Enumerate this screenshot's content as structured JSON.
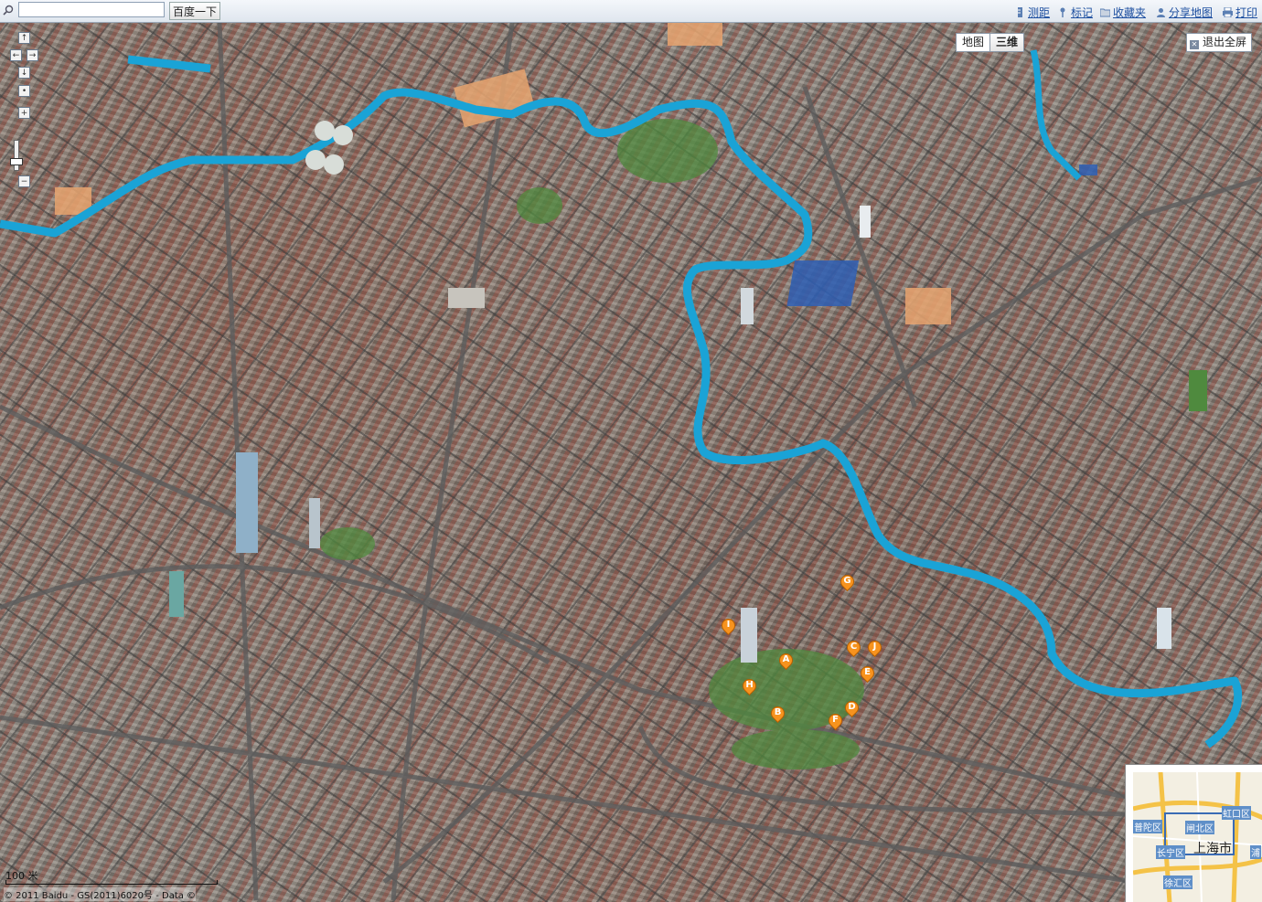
{
  "toolbar": {
    "search_placeholder": "",
    "search_button": "百度一下",
    "links": [
      {
        "id": "measure",
        "label": "测距",
        "icon": "ruler-icon"
      },
      {
        "id": "mark",
        "label": "标记",
        "icon": "pin-icon"
      },
      {
        "id": "favorites",
        "label": "收藏夹",
        "icon": "folder-icon"
      },
      {
        "id": "share",
        "label": "分享地图",
        "icon": "share-icon"
      },
      {
        "id": "print",
        "label": "打印",
        "icon": "printer-icon"
      }
    ]
  },
  "map": {
    "view": "3D aerial city view",
    "type_switch": {
      "map_label": "地图",
      "threed_label": "三维",
      "active": "三维"
    },
    "exit_fullscreen": "退出全屏",
    "markers": [
      "A",
      "B",
      "C",
      "D",
      "E",
      "F",
      "G",
      "H",
      "I",
      "J"
    ],
    "scale_label": "100 米",
    "copyright": "© 2011 Baidu - GS(2011)6020号 - Data ©",
    "colors": {
      "river": "#1aa3d6",
      "marker": "#f7931e",
      "link": "#1d4fa0"
    }
  },
  "overview": {
    "city_label": "上海市",
    "districts": [
      "普陀区",
      "闸北区",
      "虹口区",
      "长宁区",
      "浦",
      "徐汇区"
    ]
  }
}
